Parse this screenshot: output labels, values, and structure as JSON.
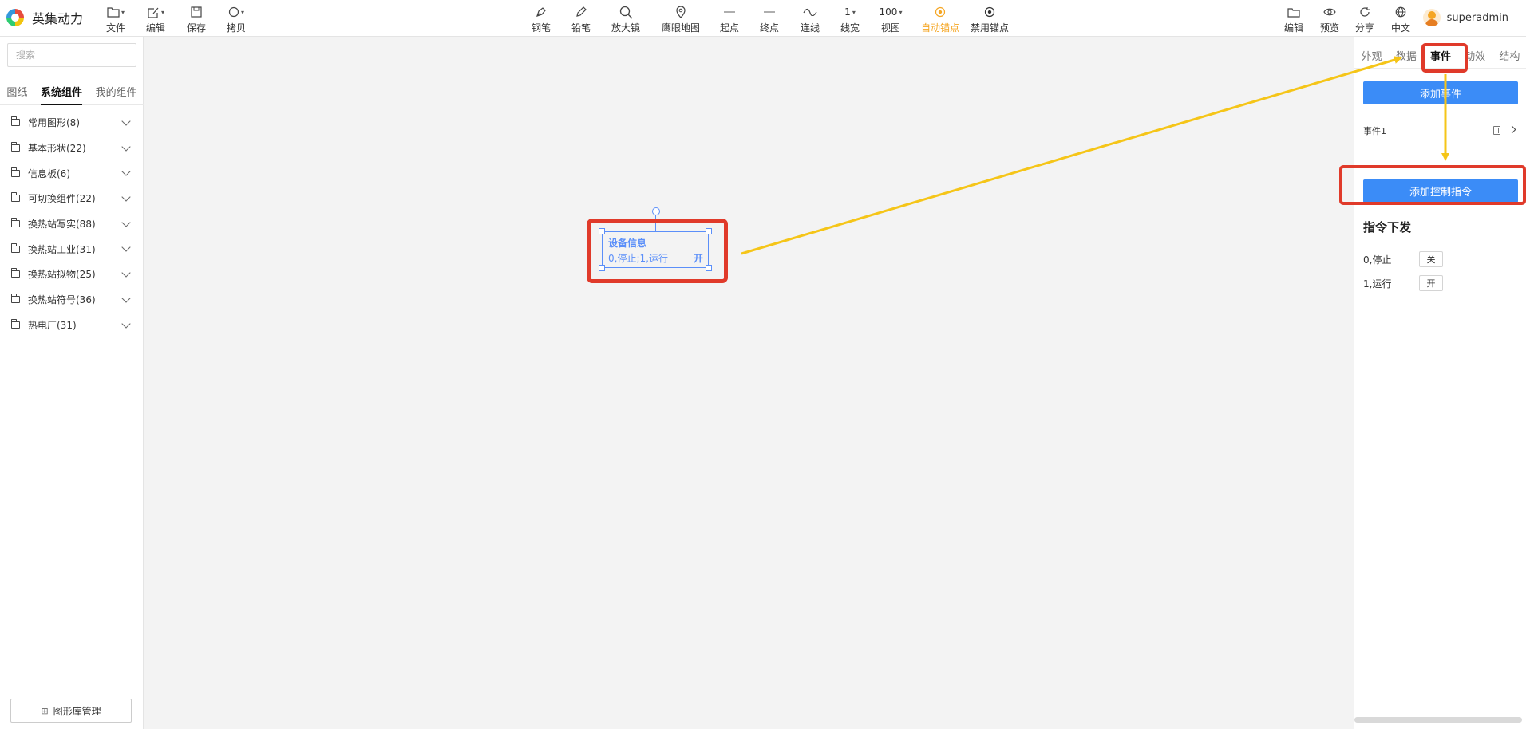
{
  "app": {
    "name": "英集动力"
  },
  "toolbar": {
    "file": "文件",
    "edit": "编辑",
    "save": "保存",
    "copy": "拷贝",
    "pen": "钢笔",
    "pencil": "铅笔",
    "magnifier": "放大镜",
    "eagle_map": "鹰眼地图",
    "start_point": "起点",
    "end_point": "终点",
    "connect": "连线",
    "line_width_value": "1",
    "line_width": "线宽",
    "view_value": "100",
    "view": "视图",
    "auto_anchor": "自动锚点",
    "disable_anchor": "禁用锚点",
    "right_edit": "编辑",
    "preview": "预览",
    "share": "分享",
    "language": "中文",
    "username": "superadmin",
    "active_color": "#f5a623"
  },
  "left": {
    "search_placeholder": "搜索",
    "tabs": [
      "图纸",
      "系统组件",
      "我的组件"
    ],
    "active_tab": "系统组件",
    "categories": [
      "常用图形(8)",
      "基本形状(22)",
      "信息板(6)",
      "可切换组件(22)",
      "换热站写实(88)",
      "换热站工业(31)",
      "换热站拟物(25)",
      "换热站符号(36)",
      "热电厂(31)"
    ],
    "gallery_button": "图形库管理"
  },
  "canvas": {
    "device_title": "设备信息",
    "device_status": "0,停止;1,运行",
    "device_state": "开",
    "selection_color": "#5b8ff9"
  },
  "right": {
    "tabs": [
      "外观",
      "数据",
      "事件",
      "动效",
      "结构"
    ],
    "active_tab": "事件",
    "add_event": "添加事件",
    "event_name": "事件1",
    "add_command": "添加控制指令",
    "section_title": "指令下发",
    "commands": [
      {
        "label": "0,停止",
        "button": "关"
      },
      {
        "label": "1,运行",
        "button": "开"
      }
    ],
    "button_color": "#3b8cf7"
  },
  "annotation": {
    "highlight_color": "#e03a2a",
    "arrow_color": "#f5c518"
  }
}
